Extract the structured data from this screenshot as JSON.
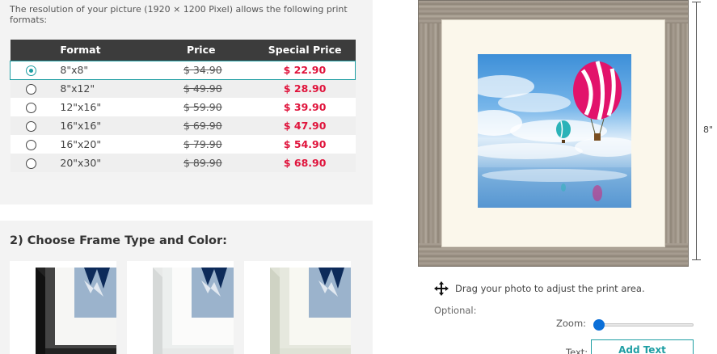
{
  "intro_text": "The resolution of your picture (1920 × 1200 Pixel) allows the following print formats:",
  "table": {
    "headers": {
      "format": "Format",
      "price": "Price",
      "special": "Special Price"
    },
    "rows": [
      {
        "format": "8\"x8\"",
        "price": "$ 34.90",
        "special": "$ 22.90",
        "selected": true
      },
      {
        "format": "8\"x12\"",
        "price": "$ 49.90",
        "special": "$ 28.90",
        "selected": false
      },
      {
        "format": "12\"x16\"",
        "price": "$ 59.90",
        "special": "$ 39.90",
        "selected": false
      },
      {
        "format": "16\"x16\"",
        "price": "$ 69.90",
        "special": "$ 47.90",
        "selected": false
      },
      {
        "format": "16\"x20\"",
        "price": "$ 79.90",
        "special": "$ 54.90",
        "selected": false
      },
      {
        "format": "20\"x30\"",
        "price": "$ 89.90",
        "special": "$ 68.90",
        "selected": false
      }
    ]
  },
  "frame_section": {
    "title": "2) Choose Frame Type and Color:",
    "options": [
      {
        "color": "black"
      },
      {
        "color": "white"
      },
      {
        "color": "whitewash"
      }
    ]
  },
  "preview": {
    "dimension_label": "8\"",
    "drag_hint": "Drag your photo to adjust the print area.",
    "optional_label": "Optional:",
    "zoom_label": "Zoom:",
    "zoom_level": 0,
    "text_label": "Text:",
    "add_text_button": "Add Text"
  },
  "colors": {
    "accent": "#1e9ea3",
    "special_price": "#e0143c",
    "header_bg": "#3c3c3c",
    "slider_thumb": "#0b6fd8"
  }
}
